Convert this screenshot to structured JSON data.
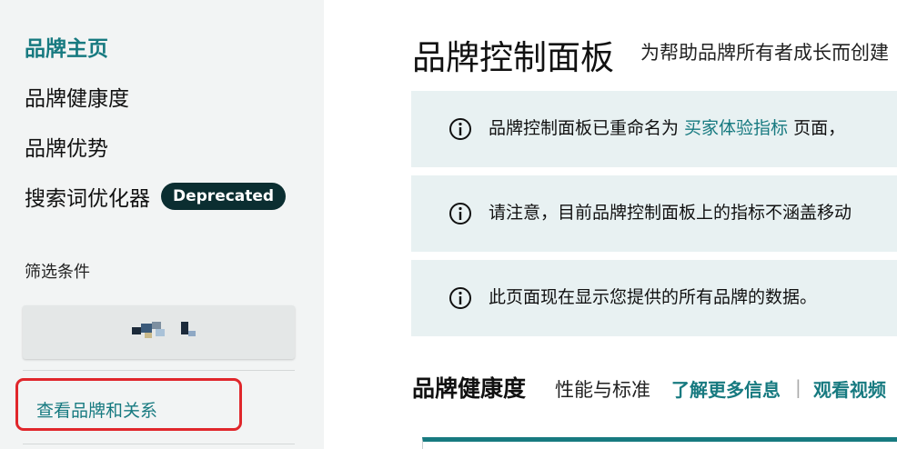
{
  "sidebar": {
    "nav": [
      {
        "label": "品牌主页",
        "active": true
      },
      {
        "label": "品牌健康度",
        "active": false
      },
      {
        "label": "品牌优势",
        "active": false
      },
      {
        "label": "搜索词优化器",
        "active": false,
        "badge": "Deprecated"
      }
    ],
    "filter_title": "筛选条件",
    "brand_link": "查看品牌和关系"
  },
  "main": {
    "title": "品牌控制面板",
    "subtitle": "为帮助品牌所有者成长而创建",
    "notices": [
      {
        "prefix": "品牌控制面板已重命名为 ",
        "link": "买家体验指标",
        "suffix": " 页面，"
      },
      {
        "prefix": "请注意，目前品牌控制面板上的指标不涵盖移动",
        "link": "",
        "suffix": ""
      },
      {
        "prefix": "此页面现在显示您提供的所有品牌的数据。",
        "link": "",
        "suffix": ""
      }
    ],
    "section": {
      "title": "品牌健康度",
      "subtitle": "性能与标准",
      "learn_more": "了解更多信息",
      "separator": "|",
      "watch_video": "观看视频"
    }
  },
  "colors": {
    "accent": "#177a80",
    "badge_bg": "#0b2e31",
    "notice_bg": "#e8f1f2",
    "sidebar_bg": "#f2f4f4",
    "highlight": "#e0262b"
  },
  "icons": [
    "info-icon"
  ]
}
